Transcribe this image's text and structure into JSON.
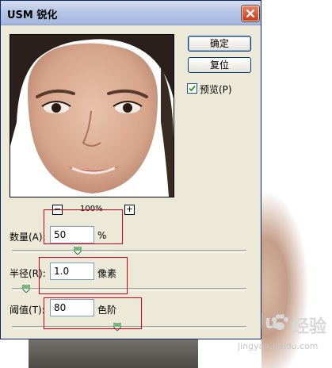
{
  "dialog": {
    "title": "USM 锐化",
    "ok_label": "确定",
    "reset_label": "复位",
    "preview_label": "预览(P)",
    "preview_checked": true,
    "zoom": "100%",
    "zoom_minus": "−",
    "zoom_plus": "+"
  },
  "fields": {
    "amount": {
      "label": "数量(A):",
      "value": "50",
      "unit": "%",
      "slider_fraction": 0.28
    },
    "radius": {
      "label": "半径(R):",
      "value": "1.0",
      "unit": "像素",
      "slider_fraction": 0.06
    },
    "threshold": {
      "label": "阈值(T):",
      "value": "80",
      "unit": "色阶",
      "slider_fraction": 0.45
    }
  },
  "watermark": {
    "logo": "Baidu",
    "logo_cn": "经验",
    "url": "jingyan.baidu.com"
  },
  "icons": [
    "close-icon",
    "checkmark-icon",
    "paw-icon"
  ],
  "colors": {
    "highlight": "#d0021b",
    "title_bar": "#b6c6e6",
    "dialog_bg": "#ece9d8"
  }
}
